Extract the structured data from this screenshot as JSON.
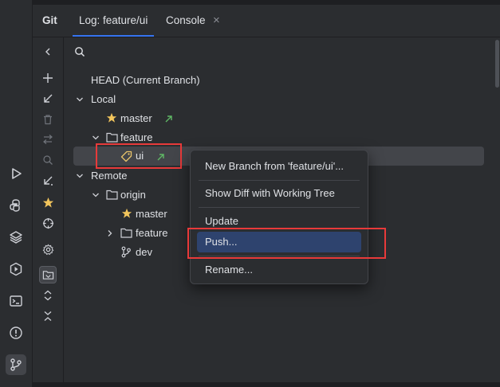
{
  "tool_window": {
    "title": "Git",
    "tabs": [
      {
        "label": "Log: feature/ui",
        "selected": true
      },
      {
        "label": "Console",
        "selected": false,
        "closable": true
      }
    ]
  },
  "close_glyph": "×",
  "left_strip_icons": [
    "run-icon",
    "python-console-icon",
    "layers-icon",
    "services-icon",
    "terminal-icon",
    "problems-icon",
    "git-icon"
  ],
  "mini_toolbar_icons": [
    "collapse-icon",
    "add-icon",
    "update-icon",
    "delete-icon",
    "compare-icon",
    "search-icon",
    "fetch-icon",
    "favorite-icon",
    "track-icon",
    "settings-icon",
    "group-by-directory-icon",
    "expand-icon",
    "collapse-all-icon"
  ],
  "branches": {
    "head": "HEAD (Current Branch)",
    "local_label": "Local",
    "local_master": "master",
    "feature_folder": "feature",
    "feature_ui": "ui",
    "remote_label": "Remote",
    "origin_label": "origin",
    "origin_master": "master",
    "origin_feature": "feature",
    "origin_dev": "dev"
  },
  "context_menu": {
    "items": [
      {
        "label": "New Branch from 'feature/ui'...",
        "highlighted": false
      },
      {
        "label": "Show Diff with Working Tree",
        "highlighted": false
      },
      {
        "label": "Update",
        "highlighted": false
      },
      {
        "label": "Push...",
        "highlighted": true
      },
      {
        "label": "Rename...",
        "highlighted": false
      }
    ]
  },
  "colors": {
    "background": "#2b2d30",
    "selection": "#43454a",
    "menu_highlight": "#2e436e",
    "accent_blue": "#3574f0",
    "star": "#f2c55c",
    "tag": "#e8c36a",
    "outgoing_arrow": "#5fb865",
    "annotation_red": "#e83a3a"
  }
}
